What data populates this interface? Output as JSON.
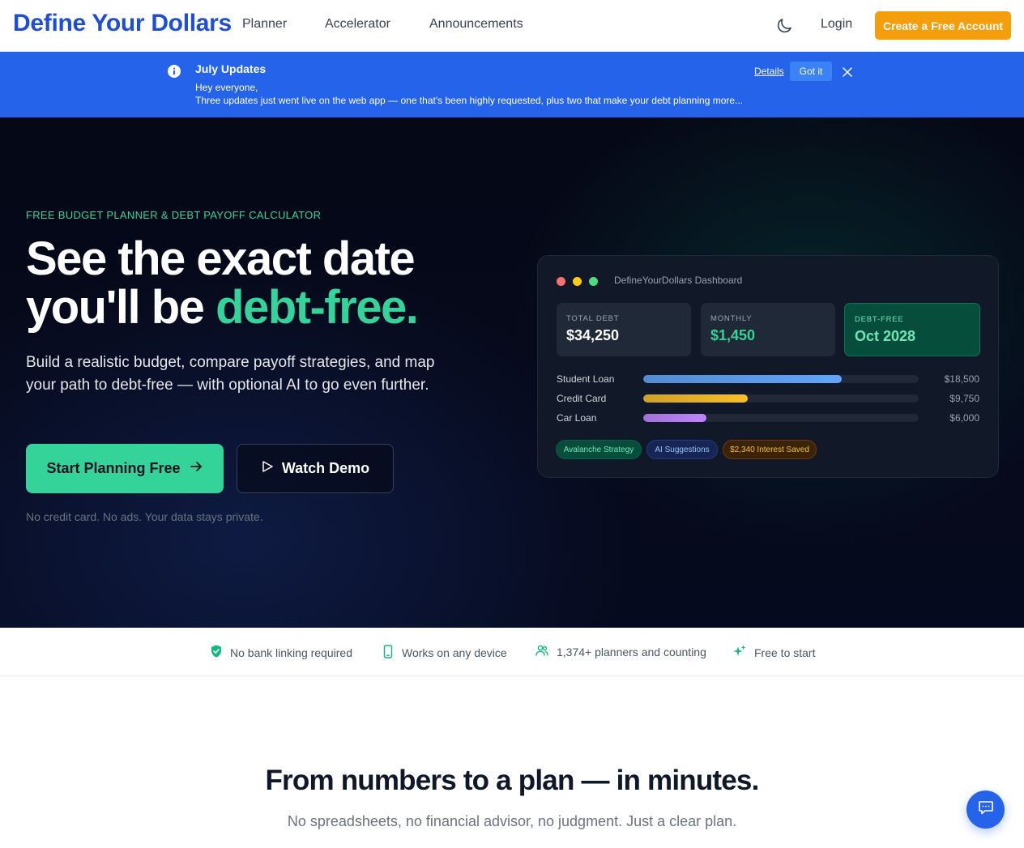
{
  "nav": {
    "brand": "Define Your Dollars",
    "links": [
      "Planner",
      "Accelerator",
      "Announcements"
    ],
    "login": "Login",
    "cta": "Create a Free Account"
  },
  "banner": {
    "title": "July Updates",
    "line1": "Hey everyone,",
    "line2": "Three updates just went live on the web app — one that's been highly requested, plus two that make your debt planning more...",
    "details": "Details",
    "got_it": "Got it"
  },
  "hero": {
    "eyebrow": "FREE BUDGET PLANNER & DEBT PAYOFF CALCULATOR",
    "headline_line1": "See the exact date",
    "headline_line2_prefix": "you'll be ",
    "headline_line2_accent": "debt-free.",
    "subcopy": "Build a realistic budget, compare payoff strategies, and map your path to debt-free — with optional AI to go even further.",
    "primary_cta": "Start Planning Free",
    "secondary_cta": "Watch Demo",
    "fineprint": "No credit card. No ads. Your data stays private."
  },
  "dashboard": {
    "title": "DefineYourDollars Dashboard",
    "stats": [
      {
        "label": "TOTAL DEBT",
        "value": "$34,250"
      },
      {
        "label": "MONTHLY",
        "value": "$1,450"
      },
      {
        "label": "DEBT-FREE",
        "value": "Oct 2028"
      }
    ],
    "debts": [
      {
        "name": "Student Loan",
        "amount": "$18,500",
        "fraction": 0.72,
        "color": "#60a5fa"
      },
      {
        "name": "Credit Card",
        "amount": "$9,750",
        "fraction": 0.38,
        "color": "#fbbf24"
      },
      {
        "name": "Car Loan",
        "amount": "$6,000",
        "fraction": 0.23,
        "color": "#c084fc"
      }
    ],
    "chips": [
      "Avalanche Strategy",
      "AI Suggestions",
      "$2,340 Interest Saved"
    ],
    "dot_colors": [
      "#f87171",
      "#facc15",
      "#4ade80"
    ]
  },
  "trust": {
    "items": [
      {
        "icon": "shield-check-icon",
        "text": "No bank linking required"
      },
      {
        "icon": "phone-icon",
        "text": "Works on any device"
      },
      {
        "icon": "users-icon",
        "text": "1,374+ planners and counting"
      },
      {
        "icon": "sparkles-icon",
        "text": "Free to start"
      }
    ]
  },
  "section": {
    "title": "From numbers to a plan — in minutes.",
    "subtitle": "No spreadsheets, no financial advisor, no judgment. Just a clear plan."
  },
  "colors": {
    "brand": "#1d4ed8",
    "accent": "#34d399",
    "cta": "#f59e0b",
    "banner": "#2563eb"
  }
}
